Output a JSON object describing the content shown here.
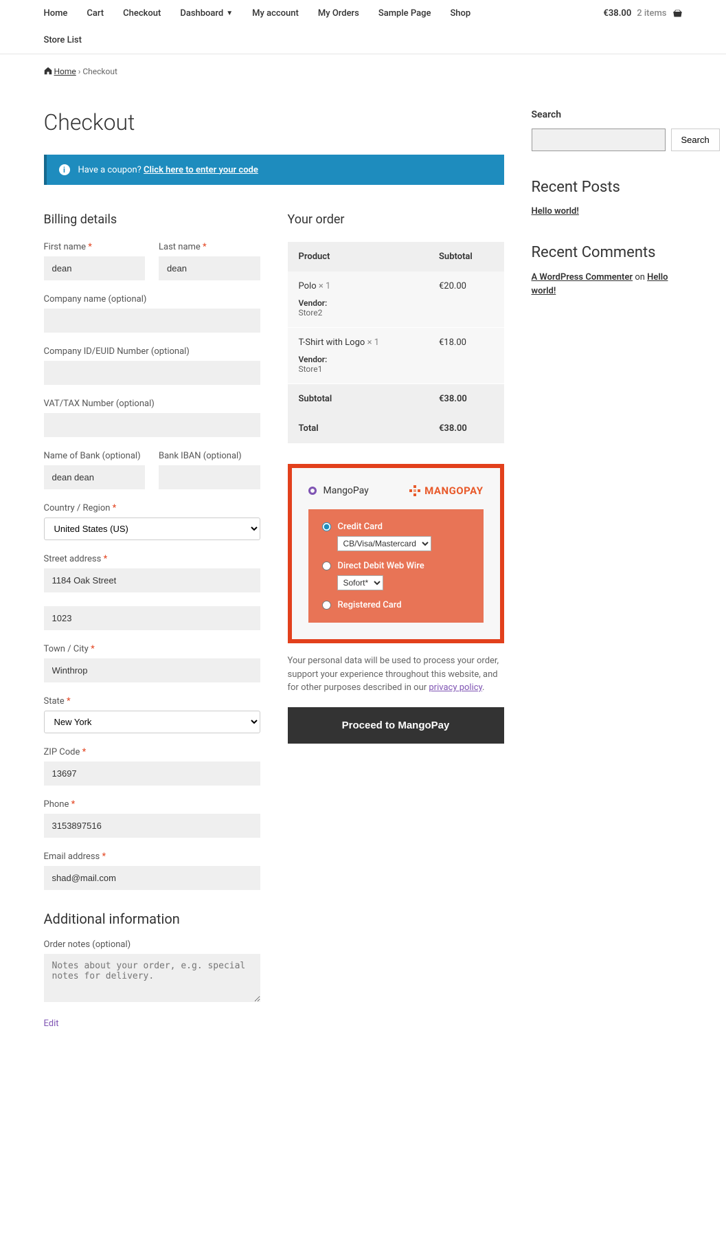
{
  "nav": {
    "items": [
      "Home",
      "Cart",
      "Checkout",
      "Dashboard",
      "My account",
      "My Orders",
      "Sample Page",
      "Shop"
    ],
    "row2": "Store List",
    "cart_total": "€38.00",
    "cart_items": "2 items"
  },
  "breadcrumb": {
    "home": "Home",
    "sep": "›",
    "current": "Checkout"
  },
  "page_title": "Checkout",
  "coupon": {
    "text": "Have a coupon?",
    "link": "Click here to enter your code"
  },
  "billing": {
    "heading": "Billing details",
    "first_name": {
      "label": "First name",
      "value": "dean"
    },
    "last_name": {
      "label": "Last name",
      "value": "dean"
    },
    "company": {
      "label": "Company name (optional)",
      "value": ""
    },
    "company_id": {
      "label": "Company ID/EUID Number (optional)",
      "value": ""
    },
    "vat": {
      "label": "VAT/TAX Number (optional)",
      "value": ""
    },
    "bank_name": {
      "label": "Name of Bank (optional)",
      "value": "dean dean"
    },
    "bank_iban": {
      "label": "Bank IBAN (optional)",
      "value": ""
    },
    "country": {
      "label": "Country / Region",
      "value": "United States (US)"
    },
    "street": {
      "label": "Street address",
      "value": "1184 Oak Street"
    },
    "street2": {
      "value": "1023"
    },
    "city": {
      "label": "Town / City",
      "value": "Winthrop"
    },
    "state": {
      "label": "State",
      "value": "New York"
    },
    "zip": {
      "label": "ZIP Code",
      "value": "13697"
    },
    "phone": {
      "label": "Phone",
      "value": "3153897516"
    },
    "email": {
      "label": "Email address",
      "value": "shad@mail.com"
    }
  },
  "additional": {
    "heading": "Additional information",
    "notes_label": "Order notes (optional)",
    "notes_placeholder": "Notes about your order, e.g. special notes for delivery."
  },
  "order": {
    "heading": "Your order",
    "col_product": "Product",
    "col_subtotal": "Subtotal",
    "items": [
      {
        "name": "Polo",
        "qty": "× 1",
        "vendor_label": "Vendor:",
        "vendor": "Store2",
        "price": "€20.00"
      },
      {
        "name": "T-Shirt with Logo",
        "qty": "× 1",
        "vendor_label": "Vendor:",
        "vendor": "Store1",
        "price": "€18.00"
      }
    ],
    "subtotal_label": "Subtotal",
    "subtotal": "€38.00",
    "total_label": "Total",
    "total": "€38.00"
  },
  "payment": {
    "gateway": "MangoPay",
    "brand": "MANGOPAY",
    "credit_card": "Credit Card",
    "cc_select": "CB/Visa/Mastercard",
    "direct_debit": "Direct Debit Web Wire",
    "dd_select": "Sofort*",
    "registered": "Registered Card",
    "privacy": "Your personal data will be used to process your order, support your experience throughout this website, and for other purposes described in our ",
    "privacy_link": "privacy policy",
    "button": "Proceed to MangoPay"
  },
  "sidebar": {
    "search_h": "Search",
    "search_btn": "Search",
    "recent_posts_h": "Recent Posts",
    "recent_posts": [
      "Hello world!"
    ],
    "recent_comments_h": "Recent Comments",
    "comment_author": "A WordPress Commenter",
    "comment_on": " on ",
    "comment_post": "Hello world!"
  },
  "edit": "Edit"
}
